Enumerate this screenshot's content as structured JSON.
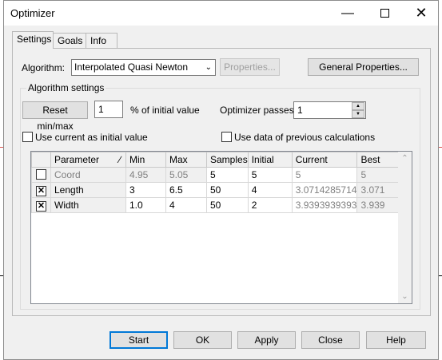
{
  "window": {
    "title": "Optimizer"
  },
  "tabs": [
    {
      "label": "Settings"
    },
    {
      "label": "Goals"
    },
    {
      "label": "Info"
    }
  ],
  "algorithm": {
    "label": "Algorithm:",
    "selected": "Interpolated Quasi Newton",
    "properties_button": "Properties...",
    "general_properties_button": "General Properties..."
  },
  "algorithm_settings": {
    "group_label": "Algorithm settings",
    "reset_button": "Reset min/max",
    "percent_value": "1",
    "percent_label": "% of initial value",
    "passes_label": "Optimizer passes:",
    "passes_value": "1",
    "use_current_label": "Use current as initial value",
    "use_previous_label": "Use data of previous calculations"
  },
  "grid": {
    "headers": [
      "Parameter",
      "Min",
      "Max",
      "Samples",
      "Initial",
      "Current",
      "Best"
    ],
    "rows": [
      {
        "checked": "",
        "parameter": "Coord",
        "min": "4.95",
        "max": "5.05",
        "samples": "5",
        "initial": "5",
        "current": "5",
        "best": "5"
      },
      {
        "checked": "✕",
        "parameter": "Length",
        "min": "3",
        "max": "6.5",
        "samples": "50",
        "initial": "4",
        "current": "3.0714285714",
        "best": "3.071"
      },
      {
        "checked": "✕",
        "parameter": "Width",
        "min": "1.0",
        "max": "4",
        "samples": "50",
        "initial": "2",
        "current": "3.9393939393",
        "best": "3.939"
      }
    ]
  },
  "footer": {
    "start": "Start",
    "ok": "OK",
    "apply": "Apply",
    "close": "Close",
    "help": "Help"
  }
}
